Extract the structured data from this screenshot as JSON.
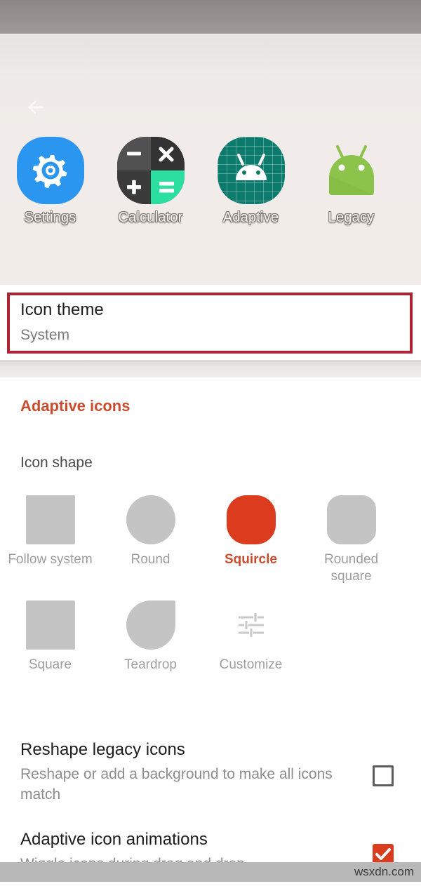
{
  "colors": {
    "accent": "#cb4b2d",
    "selected_shape": "#dc3c1e",
    "annotation_border": "#ab2434",
    "swatch_gray": "#c4c4c4",
    "settings_blue": "#2a96f0",
    "calculator_teal": "#2bdfa0",
    "adaptive_teal": "#0c7a6c",
    "legacy_green": "#8cc34a"
  },
  "header": {
    "back_label": "Back",
    "preview_icons": [
      {
        "label": "Settings",
        "icon": "settings-gear-icon"
      },
      {
        "label": "Calculator",
        "icon": "calculator-icon"
      },
      {
        "label": "Adaptive",
        "icon": "adaptive-android-icon"
      },
      {
        "label": "Legacy",
        "icon": "legacy-android-icon"
      }
    ],
    "calculator_glyphs": {
      "minus": "−",
      "times": "×",
      "plus": "+",
      "equals": "="
    }
  },
  "icon_theme": {
    "title": "Icon theme",
    "value": "System"
  },
  "adaptive_icons": {
    "section_title": "Adaptive icons",
    "icon_shape_label": "Icon shape",
    "shapes": [
      {
        "name": "Follow system",
        "shape": "square",
        "selected": false
      },
      {
        "name": "Round",
        "shape": "round",
        "selected": false
      },
      {
        "name": "Squircle",
        "shape": "squircle",
        "selected": true
      },
      {
        "name": "Rounded square",
        "shape": "rounded-square",
        "selected": false
      },
      {
        "name": "Square",
        "shape": "square",
        "selected": false
      },
      {
        "name": "Teardrop",
        "shape": "teardrop",
        "selected": false
      },
      {
        "name": "Customize",
        "shape": "tune-icon",
        "selected": false
      }
    ],
    "preferences": [
      {
        "title": "Reshape legacy icons",
        "subtitle": "Reshape or add a background to make all icons match",
        "checked": false
      },
      {
        "title": "Adaptive icon animations",
        "subtitle": "Wiggle icons during drag and drop",
        "checked": true
      }
    ]
  },
  "watermark": {
    "text": "wsxdn.com"
  }
}
